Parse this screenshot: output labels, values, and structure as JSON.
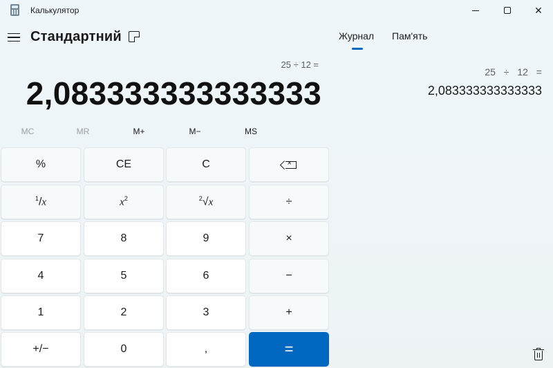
{
  "window": {
    "title": "Калькулятор",
    "close_glyph": "✕"
  },
  "header": {
    "mode": "Стандартний"
  },
  "display": {
    "expression": "25 ÷ 12 =",
    "result": "2,083333333333333"
  },
  "memory": {
    "mc": "MC",
    "mr": "MR",
    "mplus": "M+",
    "mminus": "M−",
    "ms": "MS"
  },
  "keys": {
    "percent": "%",
    "ce": "CE",
    "c": "C",
    "reciprocal_num": "1",
    "reciprocal_var": "x",
    "square_var": "x",
    "square_exp": "2",
    "sqrt_idx": "2",
    "sqrt_sym": "√",
    "sqrt_var": "x",
    "divide": "÷",
    "d7": "7",
    "d8": "8",
    "d9": "9",
    "multiply": "×",
    "d4": "4",
    "d5": "5",
    "d6": "6",
    "minus": "−",
    "d1": "1",
    "d2": "2",
    "d3": "3",
    "plus": "+",
    "negate": "+/−",
    "d0": "0",
    "decimal": ",",
    "equals": "="
  },
  "panel": {
    "tabs": {
      "journal": "Журнал",
      "memory": "Пам'ять"
    },
    "history": [
      {
        "expression": "25 ÷ 12 =",
        "result": "2,083333333333333"
      }
    ]
  },
  "colors": {
    "accent": "#0067c0",
    "background": "#eef6fa"
  },
  "icons": {
    "app": "calculator-icon",
    "menu": "hamburger-icon",
    "keep_on_top": "keep-on-top-icon",
    "backspace": "backspace-icon",
    "delete_history": "trash-icon"
  }
}
